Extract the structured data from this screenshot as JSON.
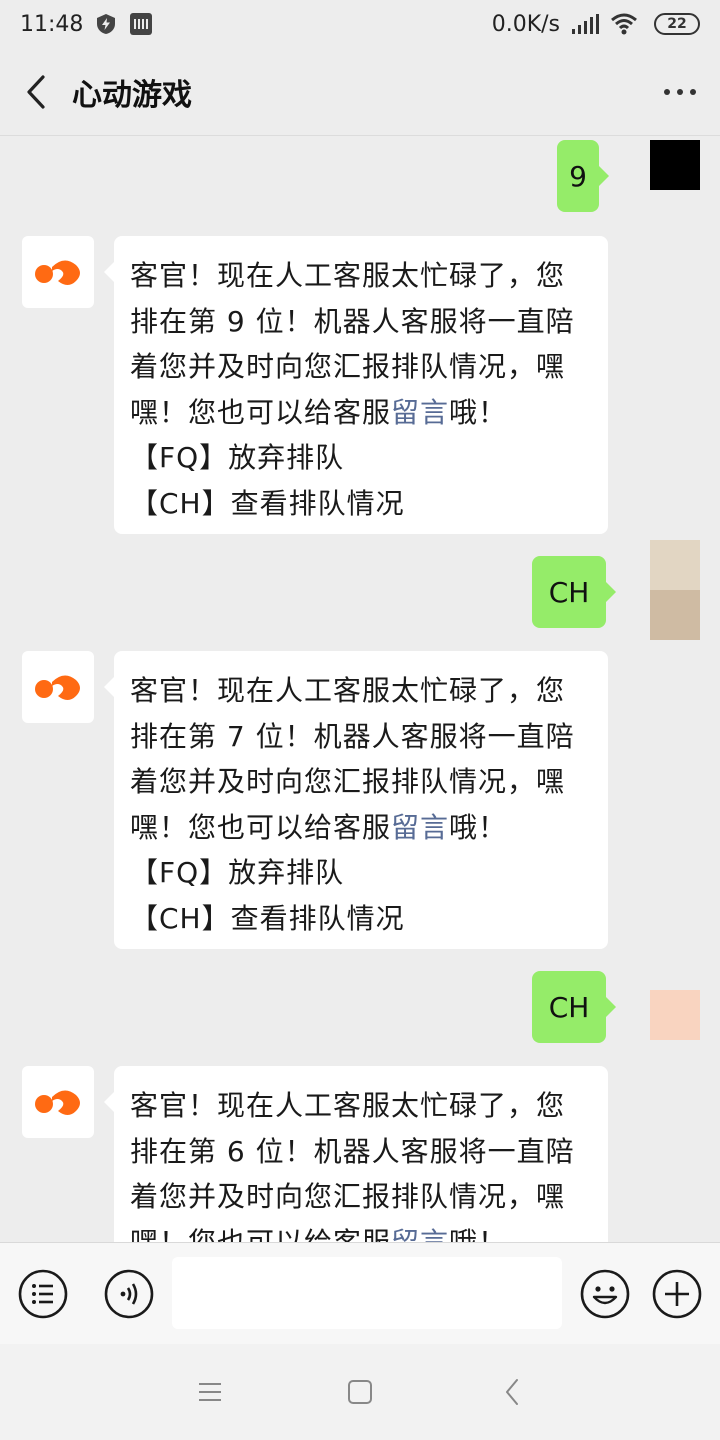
{
  "status_bar": {
    "time": "11:48",
    "net_speed": "0.0K/s",
    "battery": "22"
  },
  "header": {
    "title": "心动游戏"
  },
  "messages": [
    {
      "from": "user",
      "text": "9"
    },
    {
      "from": "bot",
      "lines": [
        "客官！现在人工客服太忙碌了，您",
        "排在第 9 位！机器人客服将一直陪",
        "着您并及时向您汇报排队情况，嘿",
        "嘿！您也可以给客服"
      ],
      "link": "留言",
      "after_link": "哦！",
      "options": [
        "【FQ】放弃排队",
        "【CH】查看排队情况"
      ]
    },
    {
      "from": "user",
      "text": "CH"
    },
    {
      "from": "bot",
      "lines": [
        "客官！现在人工客服太忙碌了，您",
        "排在第 7 位！机器人客服将一直陪",
        "着您并及时向您汇报排队情况，嘿",
        "嘿！您也可以给客服"
      ],
      "link": "留言",
      "after_link": "哦！",
      "options": [
        "【FQ】放弃排队",
        "【CH】查看排队情况"
      ]
    },
    {
      "from": "user",
      "text": "CH"
    },
    {
      "from": "bot",
      "lines": [
        "客官！现在人工客服太忙碌了，您",
        "排在第 6 位！机器人客服将一直陪",
        "着您并及时向您汇报排队情况，嘿",
        "嘿！您也可以给客服"
      ],
      "link": "留言",
      "after_link": "哦！",
      "options": []
    }
  ],
  "input": {
    "value": ""
  },
  "colors": {
    "accent_bubble": "#95ec69",
    "link": "#576b95",
    "brand_orange": "#ff6a13",
    "background": "#ededed"
  },
  "icons": {
    "back": "chevron-left-icon",
    "more": "more-dots-icon",
    "menu": "menu-list-icon",
    "voice": "voice-icon",
    "emoji": "emoji-icon",
    "add": "plus-icon"
  }
}
